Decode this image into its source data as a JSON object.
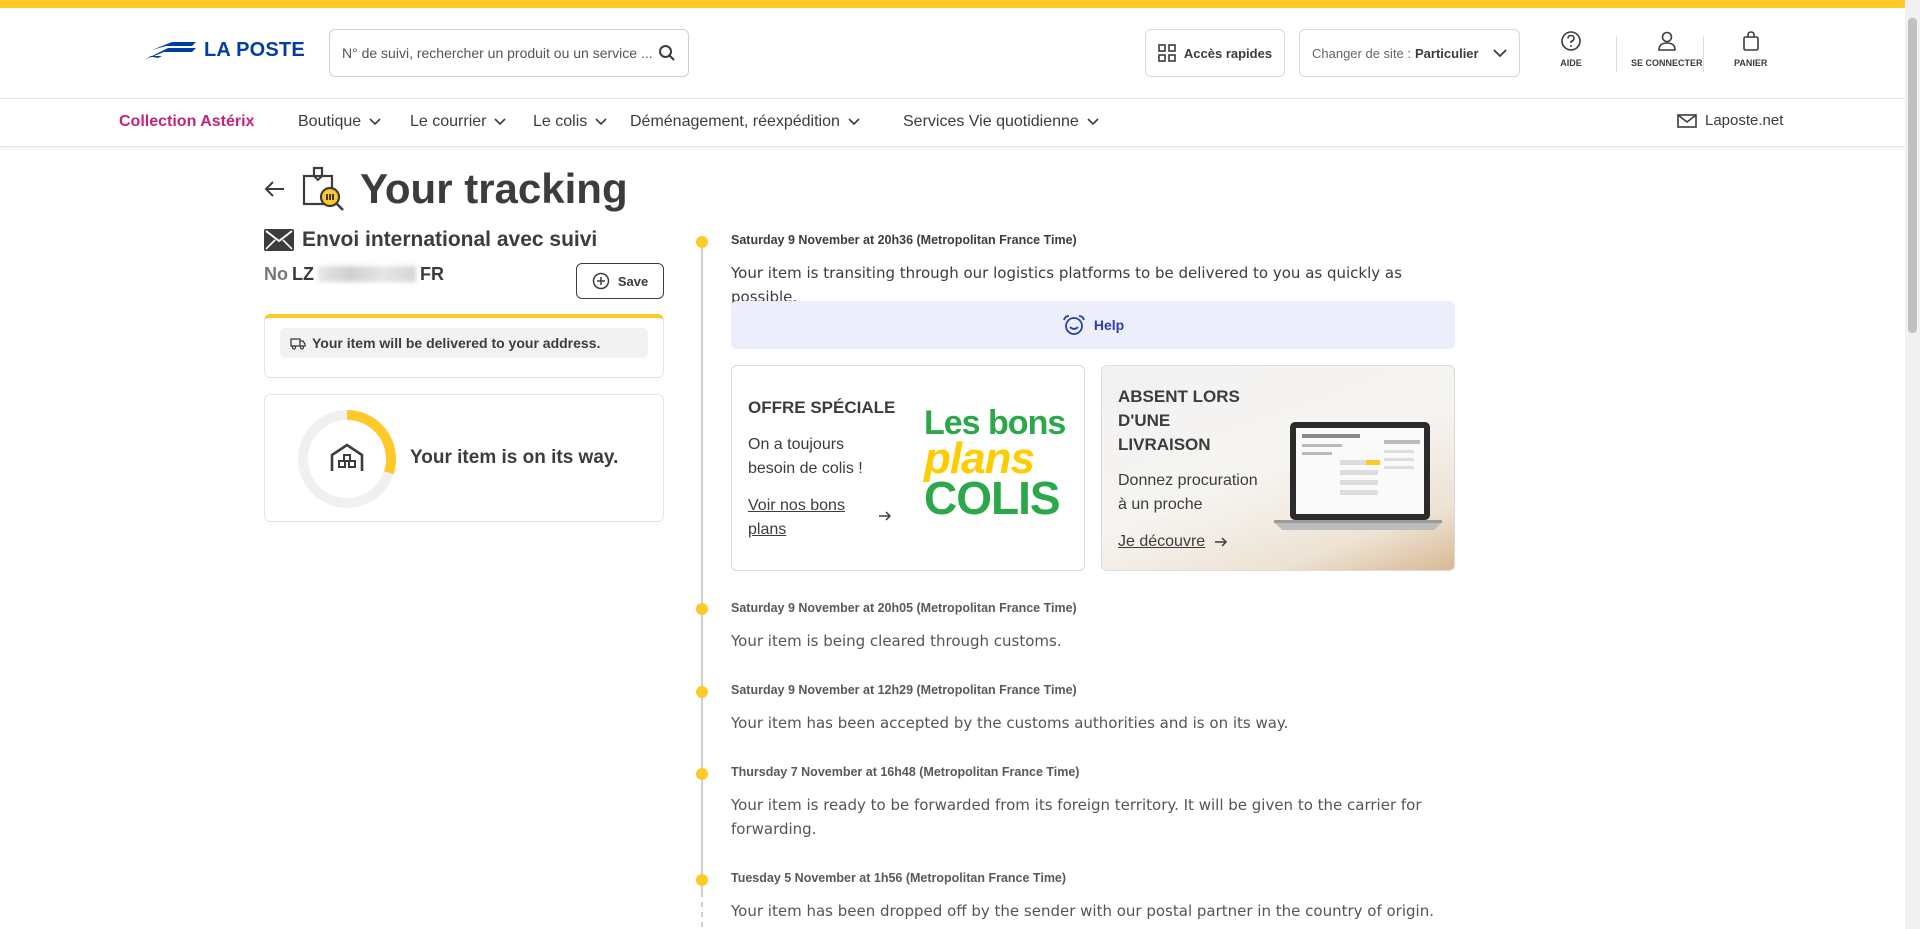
{
  "header": {
    "logo_text": "LA POSTE",
    "search_placeholder": "N° de suivi, rechercher un produit ou un service ...",
    "quick_access": "Accès rapides",
    "site_label": "Changer de site :",
    "site_value": "Particulier",
    "help": "AIDE",
    "login": "SE CONNECTER",
    "cart": "PANIER"
  },
  "nav": {
    "items": [
      {
        "label": "Collection Astérix"
      },
      {
        "label": "Boutique"
      },
      {
        "label": "Le courrier"
      },
      {
        "label": "Le colis"
      },
      {
        "label": "Déménagement, réexpédition"
      },
      {
        "label": "Services Vie quotidienne"
      }
    ],
    "laposte_net": "Laposte.net"
  },
  "page": {
    "title": "Your tracking"
  },
  "shipment": {
    "type": "Envoi international avec suivi",
    "number_label": "No",
    "number_prefix": "LZ",
    "number_suffix": "FR",
    "save_label": "Save",
    "delivery_note": "Your item will be delivered to your address.",
    "status": "Your item is on its way.",
    "progress": 0.3
  },
  "help_label": "Help",
  "promos": {
    "offer": {
      "title": "OFFRE SPÉCIALE",
      "text_line1": "On a toujours",
      "text_line2": "besoin de colis !",
      "link_line1": "Voir nos bons",
      "link_line2": "plans",
      "logo_line1": "Les bons",
      "logo_line2": "plans",
      "logo_line3": "COLIS"
    },
    "absent": {
      "title_line1": "ABSENT LORS",
      "title_line2": "D'UNE",
      "title_line3": "LIVRAISON",
      "text_line1": "Donnez procuration",
      "text_line2": "à un proche",
      "link": "Je découvre"
    }
  },
  "events": [
    {
      "date": "Saturday 9 November at 20h36 (Metropolitan France Time)",
      "text": "Your item is transiting through our logistics platforms to be delivered to you as quickly as possible."
    },
    {
      "date": "Saturday 9 November at 20h05 (Metropolitan France Time)",
      "text": "Your item is being cleared through customs."
    },
    {
      "date": "Saturday 9 November at 12h29 (Metropolitan France Time)",
      "text": "Your item has been accepted by the customs authorities and is on its way."
    },
    {
      "date": "Thursday 7 November at 16h48 (Metropolitan France Time)",
      "text_line1": "Your item is ready to be forwarded from its foreign territory. It will be given to the carrier for",
      "text_line2": "forwarding."
    },
    {
      "date": "Tuesday 5 November at 1h56 (Metropolitan France Time)",
      "text": "Your item has been dropped off by the sender with our postal partner in the country of origin."
    }
  ],
  "colors": {
    "brand_yellow": "#ffc928",
    "brand_blue": "#003da5",
    "accent_pink": "#c6237b",
    "help_bg": "#eceefb"
  }
}
